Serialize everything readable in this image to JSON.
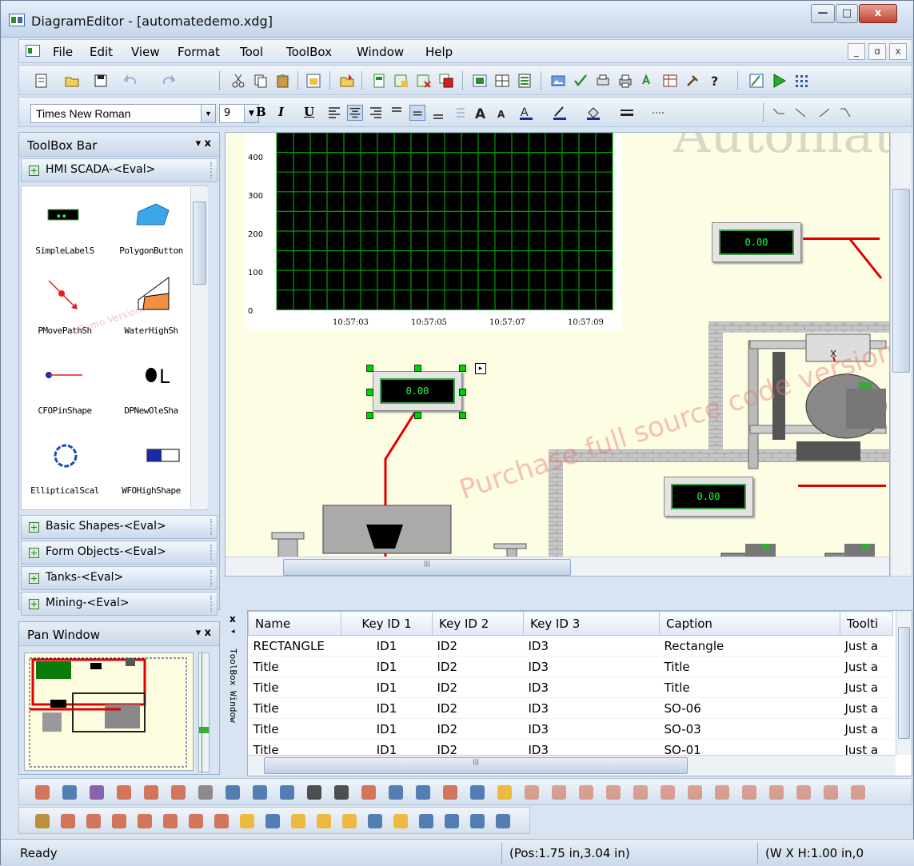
{
  "window": {
    "title": "DiagramEditor - [automatedemo.xdg]"
  },
  "window_controls": {
    "minimize": "—",
    "maximize": "□",
    "close": "x"
  },
  "menu": {
    "items": [
      "File",
      "Edit",
      "View",
      "Format",
      "Tool",
      "ToolBox",
      "Window",
      "Help"
    ]
  },
  "mdi_controls": {
    "minimize": "_",
    "restore": "ɑ",
    "close": "x"
  },
  "format_toolbar": {
    "font": "Times New Roman",
    "size": "9",
    "bold": "B",
    "italic": "I",
    "underline": "U"
  },
  "toolbox": {
    "title": "ToolBox Bar",
    "pin": "▾ x",
    "active_group": "HMI SCADA-<Eval>",
    "tools": [
      {
        "label": "SimpleLabelS",
        "icon": "label-shape-icon"
      },
      {
        "label": "PolygonButton",
        "icon": "polygon-button-icon"
      },
      {
        "label": "PMovePathSh",
        "icon": "move-path-icon"
      },
      {
        "label": "WaterHighSh",
        "icon": "water-high-icon"
      },
      {
        "label": "CFOPinShape",
        "icon": "pin-shape-icon"
      },
      {
        "label": "DPNewOleSha",
        "icon": "ole-shape-icon"
      },
      {
        "label": "EllipticalScal",
        "icon": "elliptical-scale-icon"
      },
      {
        "label": "WFOHighShape",
        "icon": "high-shape-icon"
      }
    ],
    "groups": [
      "Basic Shapes-<Eval>",
      "Form Objects-<Eval>",
      "Tanks-<Eval>",
      "Mining-<Eval>"
    ]
  },
  "pan_window": {
    "title": "Pan Window",
    "pin": "▾ x"
  },
  "canvas": {
    "heading": "Automat",
    "watermark": "Purchase full source code version",
    "chart": {
      "y_ticks": [
        "400",
        "300",
        "200",
        "100",
        "0"
      ],
      "x_ticks": [
        "10:57:03",
        "10:57:05",
        "10:57:07",
        "10:57:09"
      ]
    },
    "gauges": [
      {
        "value": "0.00"
      },
      {
        "value": "0.00"
      },
      {
        "value": "0.00"
      }
    ],
    "selection_arrow": "▸"
  },
  "toolbox_window": {
    "label": "ToolBox Window"
  },
  "grid": {
    "columns": [
      "Name",
      "Key ID 1",
      "Key ID 2",
      "Key ID 3",
      "Caption",
      "Toolti"
    ],
    "rows": [
      [
        "RECTANGLE",
        "ID1",
        "ID2",
        "ID3",
        "Rectangle",
        "Just a"
      ],
      [
        "Title",
        "ID1",
        "ID2",
        "ID3",
        "Title",
        "Just a"
      ],
      [
        "Title",
        "ID1",
        "ID2",
        "ID3",
        "Title",
        "Just a"
      ],
      [
        "Title",
        "ID1",
        "ID2",
        "ID3",
        "SO-06",
        "Just a"
      ],
      [
        "Title",
        "ID1",
        "ID2",
        "ID3",
        "SO-03",
        "Just a"
      ],
      [
        "Title",
        "ID1",
        "ID2",
        "ID3",
        "SO-01",
        "Just a"
      ]
    ]
  },
  "status": {
    "ready": "Ready",
    "pos": "(Pos:1.75 in,3.04 in)",
    "size": "(W X H:1.00 in,0"
  },
  "colors": {
    "accent": "#3a6ba8",
    "chart_grid": "#00a000",
    "lcd": "#20ff40",
    "pipe": "#e00000"
  }
}
